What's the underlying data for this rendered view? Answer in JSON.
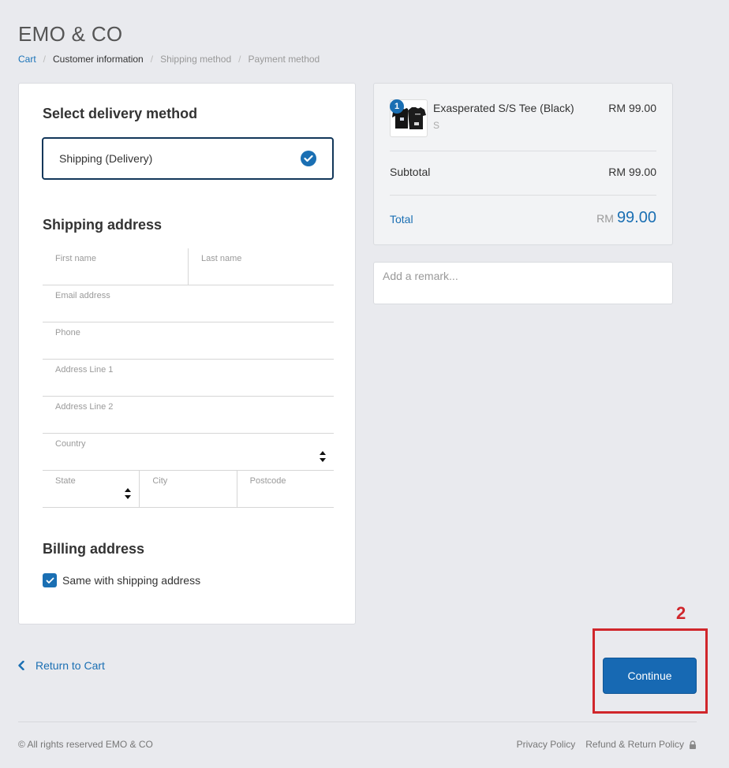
{
  "store": {
    "title": "EMO & CO"
  },
  "breadcrumb": {
    "items": [
      {
        "label": "Cart",
        "state": "link"
      },
      {
        "label": "Customer information",
        "state": "current"
      },
      {
        "label": "Shipping method",
        "state": "inactive"
      },
      {
        "label": "Payment method",
        "state": "inactive"
      }
    ],
    "separator": "/"
  },
  "delivery": {
    "heading": "Select delivery method",
    "selected_option": "Shipping (Delivery)",
    "selected_icon": "check-circle-icon"
  },
  "shipping_address": {
    "heading": "Shipping address",
    "fields": {
      "first_name": {
        "label": "First name",
        "value": ""
      },
      "last_name": {
        "label": "Last name",
        "value": ""
      },
      "email": {
        "label": "Email address",
        "value": ""
      },
      "phone": {
        "label": "Phone",
        "value": ""
      },
      "address1": {
        "label": "Address Line 1",
        "value": ""
      },
      "address2": {
        "label": "Address Line 2",
        "value": ""
      },
      "country": {
        "label": "Country",
        "value": ""
      },
      "state": {
        "label": "State",
        "value": ""
      },
      "city": {
        "label": "City",
        "value": ""
      },
      "postcode": {
        "label": "Postcode",
        "value": ""
      }
    }
  },
  "billing": {
    "heading": "Billing address",
    "same_as_shipping_label": "Same with shipping address",
    "same_as_shipping_checked": true
  },
  "order_summary": {
    "item": {
      "name": "Exasperated S/S Tee (Black)",
      "variant": "S",
      "price": "RM 99.00",
      "quantity": "1"
    },
    "subtotal_label": "Subtotal",
    "subtotal_value": "RM 99.00",
    "total_label": "Total",
    "total_currency": "RM",
    "total_amount": "99.00"
  },
  "remark": {
    "placeholder": "Add a remark..."
  },
  "actions": {
    "back_label": "Return to Cart",
    "continue_label": "Continue",
    "step_marker": "2"
  },
  "footer": {
    "copyright": "© All rights reserved EMO & CO",
    "links": [
      "Privacy Policy",
      "Refund & Return Policy"
    ],
    "lock_icon": "lock-icon"
  },
  "colors": {
    "accent": "#1a6fb3",
    "highlight": "#d0262b",
    "background": "#e9eaee"
  }
}
